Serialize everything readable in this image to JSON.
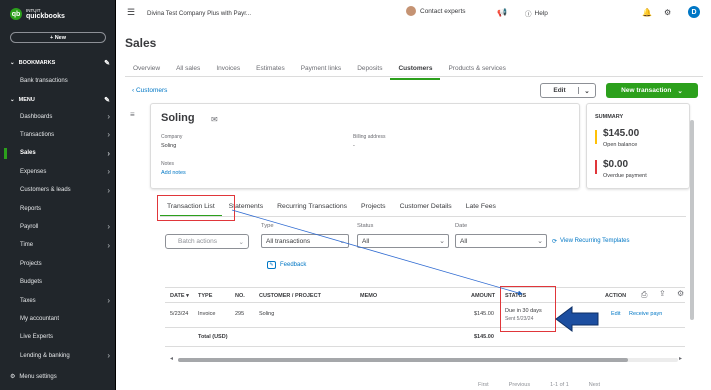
{
  "sidebar": {
    "logo_small": "INTUIT",
    "logo_name": "quickbooks",
    "new_label": "+ New",
    "bookmarks_label": "BOOKMARKS",
    "bookmarks": [
      "Bank transactions"
    ],
    "menu_label": "MENU",
    "items": [
      {
        "label": "Dashboards",
        "chevron": true
      },
      {
        "label": "Transactions",
        "chevron": true
      },
      {
        "label": "Sales",
        "chevron": true,
        "active": true
      },
      {
        "label": "Expenses",
        "chevron": true
      },
      {
        "label": "Customers & leads",
        "chevron": true
      },
      {
        "label": "Reports",
        "chevron": false
      },
      {
        "label": "Payroll",
        "chevron": true
      },
      {
        "label": "Time",
        "chevron": true
      },
      {
        "label": "Projects",
        "chevron": false
      },
      {
        "label": "Budgets",
        "chevron": false
      },
      {
        "label": "Taxes",
        "chevron": true
      },
      {
        "label": "My accountant",
        "chevron": false
      },
      {
        "label": "Live Experts",
        "chevron": false
      },
      {
        "label": "Lending & banking",
        "chevron": true
      }
    ],
    "menu_settings": "Menu settings"
  },
  "topbar": {
    "company": "Divina Test Company Plus with Payr...",
    "contact": "Contact experts",
    "help": "Help",
    "avatar_initial": "D"
  },
  "page": {
    "title": "Sales",
    "tabs": [
      "Overview",
      "All sales",
      "Invoices",
      "Estimates",
      "Payment links",
      "Deposits",
      "Customers",
      "Products & services"
    ],
    "active_tab": "Customers"
  },
  "customer": {
    "back_label": "Customers",
    "edit_label": "Edit",
    "new_transaction_label": "New transaction",
    "name": "Soling",
    "company_label": "Company",
    "company_value": "Soling",
    "billing_label": "Billing address",
    "billing_value": "-",
    "notes_label": "Notes",
    "add_notes": "Add notes"
  },
  "summary": {
    "title": "SUMMARY",
    "open_balance": "$145.00",
    "open_balance_label": "Open balance",
    "overdue": "$0.00",
    "overdue_label": "Overdue payment",
    "colors": {
      "open": "#ffc107",
      "overdue": "#e0363a"
    }
  },
  "subtabs": [
    "Transaction List",
    "Statements",
    "Recurring Transactions",
    "Projects",
    "Customer Details",
    "Late Fees"
  ],
  "filters": {
    "batch_actions": "Batch actions",
    "type_label": "Type",
    "type_value": "All transactions",
    "status_label": "Status",
    "status_value": "All",
    "date_label": "Date",
    "date_value": "All",
    "view_recurring": "View Recurring Templates",
    "feedback": "Feedback"
  },
  "table": {
    "headers": {
      "date": "DATE ▾",
      "type": "TYPE",
      "no": "NO.",
      "customer": "CUSTOMER / PROJECT",
      "memo": "MEMO",
      "amount": "AMOUNT",
      "status": "STATUS",
      "action": "ACTION"
    },
    "row": {
      "date": "5/23/24",
      "type": "Invoice",
      "no": "295",
      "customer": "Soling",
      "memo": "",
      "amount": "$145.00",
      "status_line1": "Due in 30 days",
      "status_line2": "Sent 5/23/24",
      "action_edit": "Edit",
      "action_receive": "Receive payn"
    },
    "total_label": "Total (USD)",
    "total_amount": "$145.00"
  },
  "pager": {
    "first": "First",
    "previous": "Previous",
    "range": "1-1 of 1",
    "next": "Next"
  },
  "accent": "#2ca01c",
  "link_color": "#0077c5",
  "annotation_color": "#e0363a"
}
